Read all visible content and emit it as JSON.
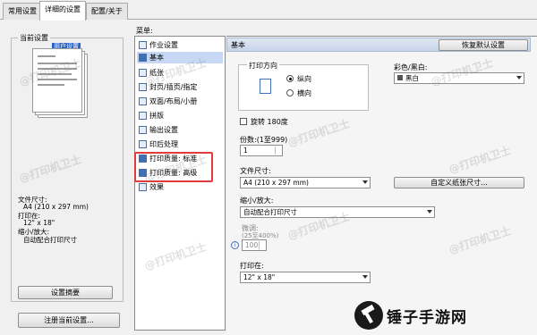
{
  "tabs": [
    "常用设置",
    "详细的设置",
    "配置/关于"
  ],
  "left": {
    "current_settings_title": "当前设置",
    "preview_label": "用户设置",
    "info": {
      "paper_size_label": "文件尺寸:",
      "paper_size_value": "A4 (210 x 297 mm)",
      "print_on_label": "打印在:",
      "print_on_value": "12\" x 18\"",
      "zoom_label": "缩小/放大:",
      "zoom_value": "自动配合打印尺寸"
    },
    "summary_button": "设置摘要",
    "register_button": "注册当前设置..."
  },
  "menu": {
    "label": "菜单:",
    "items": [
      {
        "label": "作业设置",
        "icon": "job-settings-icon"
      },
      {
        "label": "基本",
        "icon": "basic-icon"
      },
      {
        "label": "纸张",
        "icon": "paper-icon"
      },
      {
        "label": "封页/插页/指定",
        "icon": "cover-icon"
      },
      {
        "label": "双面/布局/小册",
        "icon": "duplex-icon"
      },
      {
        "label": "拼版",
        "icon": "imposition-icon"
      },
      {
        "label": "输出设置",
        "icon": "output-icon"
      },
      {
        "label": "印后处理",
        "icon": "finishing-icon"
      },
      {
        "label": "打印质量: 标准",
        "icon": "print-quality-standard-icon"
      },
      {
        "label": "打印质量: 高级",
        "icon": "print-quality-advanced-icon"
      },
      {
        "label": "效果",
        "icon": "effects-icon"
      }
    ],
    "selected_index": 1
  },
  "main": {
    "section_title": "基本",
    "restore_button": "恢复默认设置",
    "orientation_label": "打印方向",
    "orientation_options": [
      "纵向",
      "横向"
    ],
    "orientation_selected": "纵向",
    "color_label": "彩色/黑白:",
    "color_value": "黑白",
    "rotate_label": "旋转 180度",
    "copies_label": "份数:(1至999)",
    "copies_value": "1",
    "paper_size_label": "文件尺寸:",
    "paper_size_value": "A4 (210 x 297 mm)",
    "custom_paper_button": "自定义纸张尺寸...",
    "zoom_label": "缩小/放大:",
    "zoom_value": "自动配合打印尺寸",
    "fine_label": "微调:",
    "fine_range": "(25至400%)",
    "fine_value": "100",
    "print_on_label": "打印在:",
    "print_on_value": "12\" x 18\""
  },
  "watermark_text": "@打印机卫士",
  "brand": {
    "name": "锤子手游网"
  },
  "colors": {
    "highlight": "#e23b3b",
    "selection": "#c7d8f5"
  }
}
